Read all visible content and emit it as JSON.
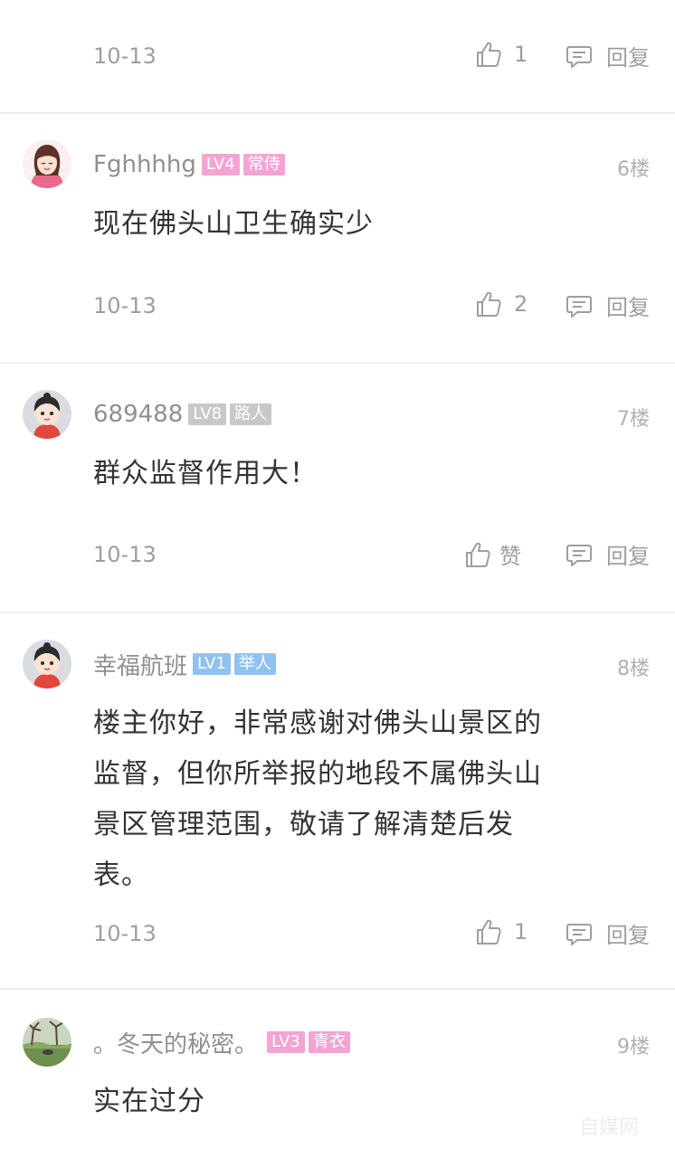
{
  "top_item": {
    "date": "10-13",
    "likes": "1",
    "reply": "回复"
  },
  "comments": [
    {
      "username": "Fghhhhg",
      "level": "LV4",
      "title": "常侍",
      "floor": "6楼",
      "text": "现在佛头山卫生确实少",
      "date": "10-13",
      "likes": "2",
      "reply": "回复",
      "badge_color": "#f3a4d4"
    },
    {
      "username": "689488",
      "level": "LV8",
      "title": "路人",
      "floor": "7楼",
      "text": "群众监督作用大！",
      "date": "10-13",
      "likes": "赞",
      "reply": "回复",
      "badge_color": "#c8c8c8"
    },
    {
      "username": "幸福航班",
      "level": "LV1",
      "title": "举人",
      "floor": "8楼",
      "text_lines": [
        "楼主你好，非常感谢对佛头山景区的",
        "监督，但你所举报的地段不属佛头山",
        "景区管理范围，敬请了解清楚后发",
        "表。"
      ],
      "date": "10-13",
      "likes": "1",
      "reply": "回复",
      "badge_color": "#8fc2f0"
    },
    {
      "username": "。冬天的秘密。",
      "level": "LV3",
      "title": "青衣",
      "floor": "9楼",
      "text": "实在过分",
      "badge_color": "#f3a4d4"
    }
  ],
  "watermark": "自媒网"
}
